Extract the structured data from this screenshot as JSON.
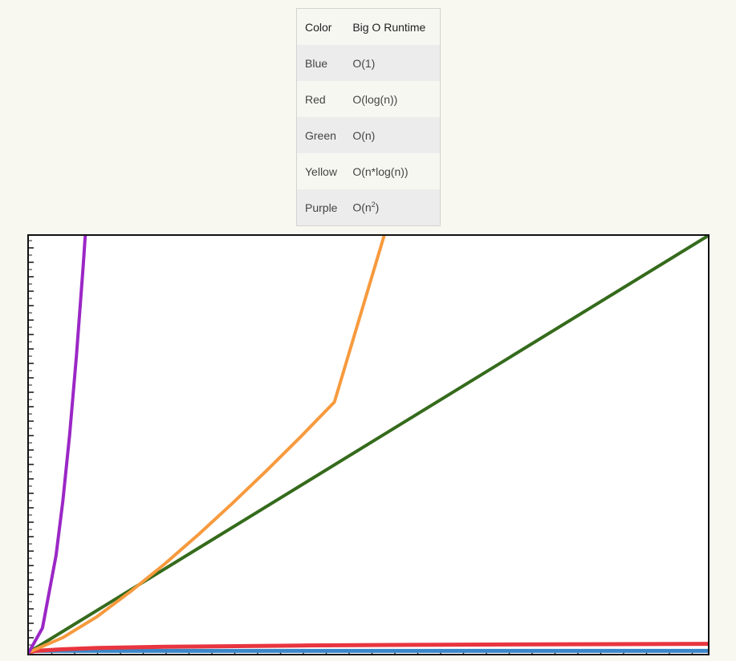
{
  "table": {
    "headers": [
      "Color",
      "Big O Runtime"
    ],
    "rows": [
      {
        "color": "Blue",
        "runtime": "O(1)"
      },
      {
        "color": "Red",
        "runtime": "O(log(n))"
      },
      {
        "color": "Green",
        "runtime": "O(n)"
      },
      {
        "color": "Yellow",
        "runtime": "O(n*log(n))"
      },
      {
        "color": "Purple",
        "runtime_prefix": "O(n",
        "runtime_sup": "2",
        "runtime_suffix": ")"
      }
    ]
  },
  "chart_data": {
    "type": "line",
    "title": "",
    "xlabel": "",
    "ylabel": "",
    "xlim": [
      0,
      100
    ],
    "ylim": [
      0,
      100
    ],
    "grid": false,
    "series": [
      {
        "name": "Blue",
        "function": "O(1)",
        "color": "#3a86c8",
        "x": [
          0,
          100
        ],
        "y": [
          0.3,
          0.3
        ]
      },
      {
        "name": "Red",
        "function": "O(log(n))",
        "color": "#e8353f",
        "x": [
          0,
          1,
          5,
          10,
          20,
          40,
          60,
          80,
          100
        ],
        "y": [
          0,
          0.3,
          0.7,
          1.0,
          1.3,
          1.6,
          1.8,
          1.9,
          2.0
        ]
      },
      {
        "name": "Green",
        "function": "O(n)",
        "color": "#356b1c",
        "x": [
          0,
          100
        ],
        "y": [
          0,
          100
        ]
      },
      {
        "name": "Yellow",
        "function": "O(n*log(n))",
        "color": "#f79a3e",
        "x": [
          0,
          5,
          10,
          15,
          20,
          25,
          30,
          35,
          40,
          45,
          52.3
        ],
        "y": [
          0,
          3.5,
          8.5,
          14.6,
          21.2,
          28.3,
          35.8,
          43.6,
          51.7,
          60.1,
          100
        ]
      },
      {
        "name": "Purple",
        "function": "O(n^2)",
        "color": "#9b27c6",
        "x": [
          0,
          2,
          4,
          5,
          6,
          7,
          8,
          8.3
        ],
        "y": [
          0,
          5.8,
          23.2,
          36.3,
          52.3,
          71.1,
          92.9,
          100
        ]
      }
    ]
  }
}
